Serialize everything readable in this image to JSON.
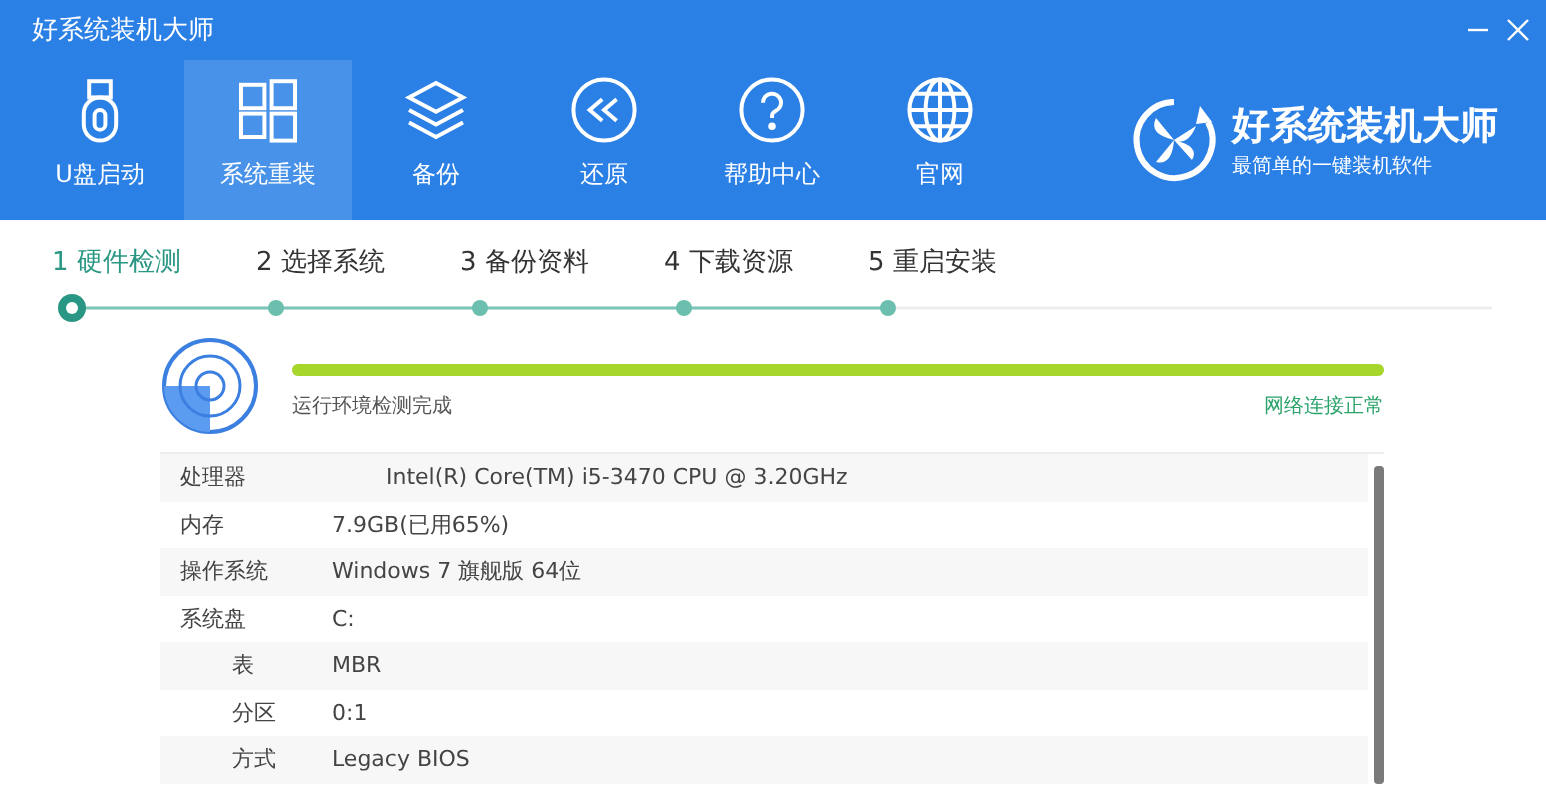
{
  "window": {
    "title": "好系统装机大师"
  },
  "nav": [
    {
      "label": "U盘启动",
      "selected": false
    },
    {
      "label": "系统重装",
      "selected": true
    },
    {
      "label": "备份",
      "selected": false
    },
    {
      "label": "还原",
      "selected": false
    },
    {
      "label": "帮助中心",
      "selected": false
    },
    {
      "label": "官网",
      "selected": false
    }
  ],
  "logo": {
    "name": "好系统装机大师",
    "slogan": "最简单的一键装机软件"
  },
  "steps": [
    {
      "label": "1 硬件检测",
      "selected": true
    },
    {
      "label": "2 选择系统",
      "selected": false
    },
    {
      "label": "3 备份资料",
      "selected": false
    },
    {
      "label": "4 下载资源",
      "selected": false
    },
    {
      "label": "5 重启安装",
      "selected": false
    }
  ],
  "check": {
    "level": 1,
    "status": "运行环境检测完成",
    "network": "网络连接正常"
  },
  "info_rows": [
    {
      "label": "处理器",
      "value": "Intel(R) Core(TM) i5-3470 CPU @ 3.20GHz"
    },
    {
      "label": "内存",
      "value": "7.9GB(已用65%)"
    },
    {
      "label": "操作系统",
      "value": "Windows 7 旗舰版 64位"
    },
    {
      "label": "系统盘",
      "value": "C:"
    },
    {
      "label": "表",
      "value": "MBR"
    },
    {
      "label": "分区",
      "value": "0:1"
    },
    {
      "label": "方式",
      "value": "Legacy BIOS"
    }
  ]
}
